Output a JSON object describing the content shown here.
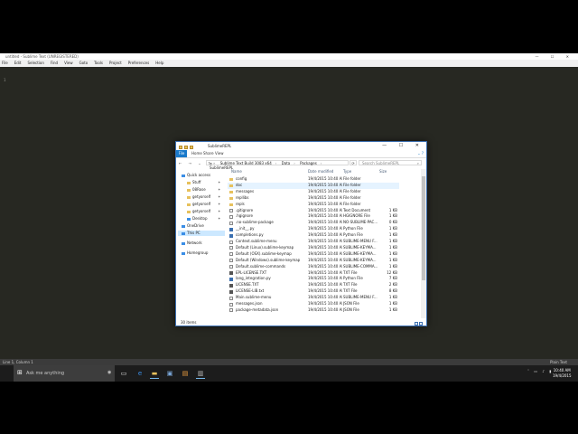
{
  "sublime": {
    "title": "untitled - Sublime Text (UNREGISTERED)",
    "menu": [
      "File",
      "Edit",
      "Selection",
      "Find",
      "View",
      "Goto",
      "Tools",
      "Project",
      "Preferences",
      "Help"
    ],
    "line_number": "1",
    "status_left": "Line 1, Column 1",
    "status_right": "Plain Text"
  },
  "explorer": {
    "title": "SublimeREPL",
    "ribbon": {
      "file": "File",
      "tabs": [
        "Home",
        "Share",
        "View"
      ]
    },
    "address": [
      "Sublime Text Build 3083 x64",
      "Data",
      "Packages",
      "SublimeREPL"
    ],
    "search_placeholder": "Search SublimeREPL",
    "columns": {
      "name": "Name",
      "date": "Date modified",
      "type": "Type",
      "size": "Size"
    },
    "nav": [
      {
        "label": "Quick access",
        "icon": "star-icon"
      },
      {
        "label": "Stuff",
        "icon": "folder-icon"
      },
      {
        "label": "08Rose",
        "icon": "folder-icon"
      },
      {
        "label": "getyorself",
        "icon": "folder-icon"
      },
      {
        "label": "getyorself",
        "icon": "folder-icon"
      },
      {
        "label": "getyorself",
        "icon": "folder-icon"
      },
      {
        "label": "Desktop",
        "icon": "desktop-icon"
      },
      {
        "label": "OneDrive",
        "icon": "cloud-icon"
      },
      {
        "label": "This PC",
        "icon": "computer-icon"
      },
      {
        "label": "Network",
        "icon": "network-icon"
      },
      {
        "label": "Homegroup",
        "icon": "homegroup-icon"
      }
    ],
    "files": [
      {
        "name": "config",
        "date": "19/4/2015 10:40 AM",
        "type": "File folder",
        "size": "",
        "icon": "folder"
      },
      {
        "name": "doc",
        "date": "19/4/2015 10:40 AM",
        "type": "File folder",
        "size": "",
        "icon": "folder"
      },
      {
        "name": "messages",
        "date": "19/4/2015 10:40 AM",
        "type": "File folder",
        "size": "",
        "icon": "folder"
      },
      {
        "name": "repllibs",
        "date": "19/4/2015 10:40 AM",
        "type": "File folder",
        "size": "",
        "icon": "folder"
      },
      {
        "name": "repls",
        "date": "19/4/2015 10:40 AM",
        "type": "File folder",
        "size": "",
        "icon": "folder"
      },
      {
        "name": ".gitignore",
        "date": "19/4/2015 10:40 AM",
        "type": "Text Document",
        "size": "1 KB",
        "icon": "file"
      },
      {
        "name": ".hgignore",
        "date": "19/4/2015 10:40 AM",
        "type": "HGIGNORE File",
        "size": "1 KB",
        "icon": "file"
      },
      {
        "name": ".no-sublime-package",
        "date": "19/4/2015 10:40 AM",
        "type": "NO-SUBLIME-PAC...",
        "size": "0 KB",
        "icon": "file"
      },
      {
        "name": "__init__.py",
        "date": "19/4/2015 10:40 AM",
        "type": "Python File",
        "size": "1 KB",
        "icon": "py"
      },
      {
        "name": "completions.py",
        "date": "19/4/2015 10:40 AM",
        "type": "Python File",
        "size": "1 KB",
        "icon": "py"
      },
      {
        "name": "Context.sublime-menu",
        "date": "19/4/2015 10:40 AM",
        "type": "SUBLIME-MENU F...",
        "size": "1 KB",
        "icon": "file"
      },
      {
        "name": "Default (Linux).sublime-keymap",
        "date": "19/4/2015 10:40 AM",
        "type": "SUBLIME-KEYMA...",
        "size": "1 KB",
        "icon": "file"
      },
      {
        "name": "Default (OSX).sublime-keymap",
        "date": "19/4/2015 10:40 AM",
        "type": "SUBLIME-KEYMA...",
        "size": "1 KB",
        "icon": "file"
      },
      {
        "name": "Default (Windows).sublime-keymap",
        "date": "19/4/2015 10:40 AM",
        "type": "SUBLIME-KEYMA...",
        "size": "1 KB",
        "icon": "file"
      },
      {
        "name": "Default.sublime-commands",
        "date": "19/4/2015 10:40 AM",
        "type": "SUBLIME-COMMA...",
        "size": "1 KB",
        "icon": "file"
      },
      {
        "name": "EPL-LICENSE.TXT",
        "date": "19/4/2015 10:40 AM",
        "type": "TXT File",
        "size": "12 KB",
        "icon": "txt"
      },
      {
        "name": "lang_integration.py",
        "date": "19/4/2015 10:40 AM",
        "type": "Python File",
        "size": "7 KB",
        "icon": "py"
      },
      {
        "name": "LICENSE.TXT",
        "date": "19/4/2015 10:40 AM",
        "type": "TXT File",
        "size": "2 KB",
        "icon": "txt"
      },
      {
        "name": "LICENSE-LIB.txt",
        "date": "19/4/2015 10:40 AM",
        "type": "TXT File",
        "size": "8 KB",
        "icon": "txt"
      },
      {
        "name": "Main.sublime-menu",
        "date": "19/4/2015 10:40 AM",
        "type": "SUBLIME-MENU F...",
        "size": "1 KB",
        "icon": "file"
      },
      {
        "name": "messages.json",
        "date": "19/4/2015 10:40 AM",
        "type": "JSON File",
        "size": "1 KB",
        "icon": "file"
      },
      {
        "name": "package-metadata.json",
        "date": "19/4/2015 10:40 AM",
        "type": "JSON File",
        "size": "1 KB",
        "icon": "file"
      }
    ],
    "status": "30 items"
  },
  "taskbar": {
    "search_placeholder": "Ask me anything",
    "time": "10:40 AM",
    "date": "19/4/2015"
  }
}
